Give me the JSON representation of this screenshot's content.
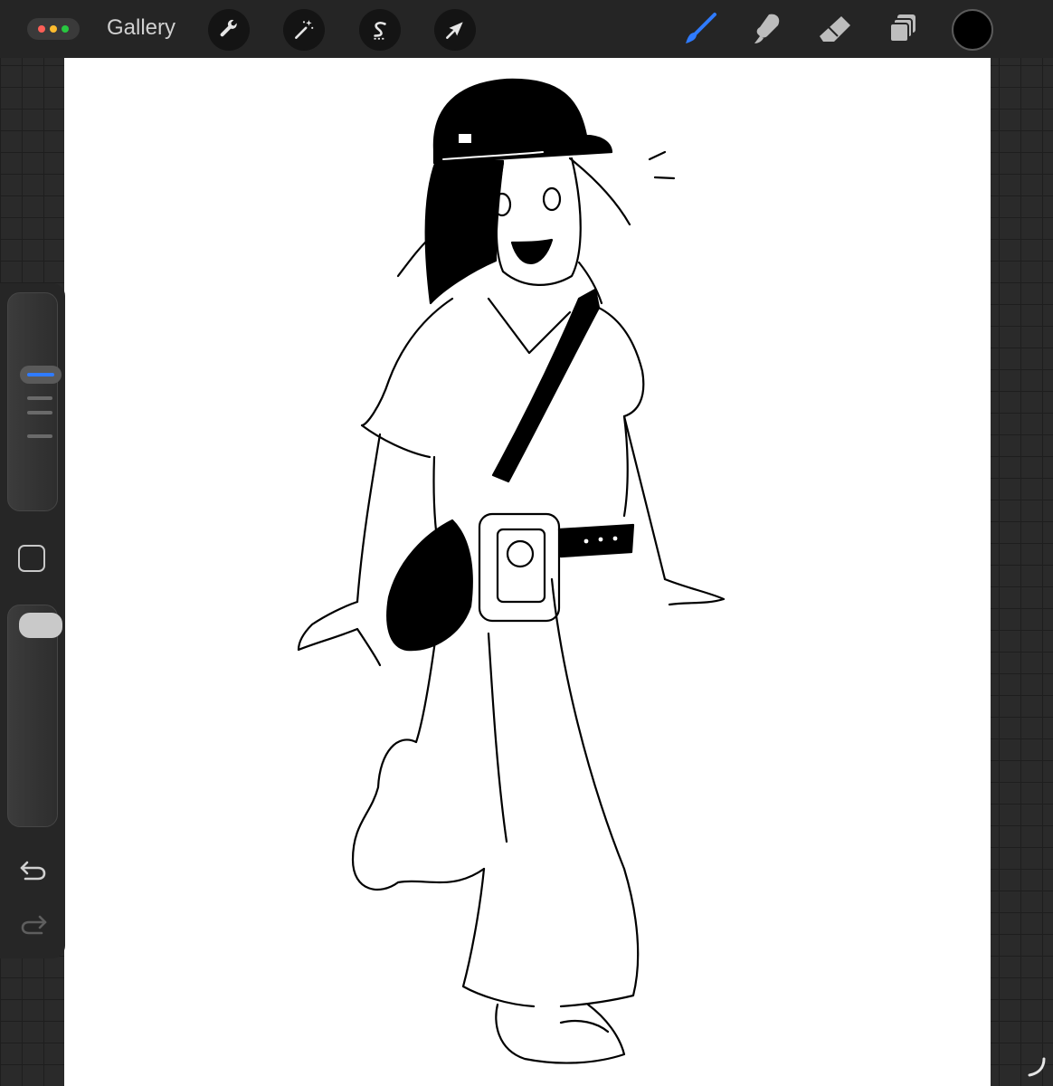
{
  "app": {
    "gallery_label": "Gallery"
  },
  "window_controls": {
    "colors": [
      "#ff5f57",
      "#febc2e",
      "#28c840"
    ]
  },
  "toolbar": {
    "left_tools": [
      "wrench-icon",
      "magic-wand-icon",
      "selection-s-icon",
      "transform-arrow-icon"
    ],
    "right_tools": [
      "brush-icon",
      "smudge-icon",
      "eraser-icon",
      "layers-icon"
    ],
    "active_tool": "brush-icon",
    "active_color": "#000000",
    "accent_color": "#2f7bff"
  },
  "sidebar": {
    "brush_size_level": 0.2,
    "opacity_level": 0.0,
    "controls": [
      "brush-size-slider",
      "modify-button",
      "opacity-slider",
      "undo-icon",
      "redo-icon"
    ]
  }
}
